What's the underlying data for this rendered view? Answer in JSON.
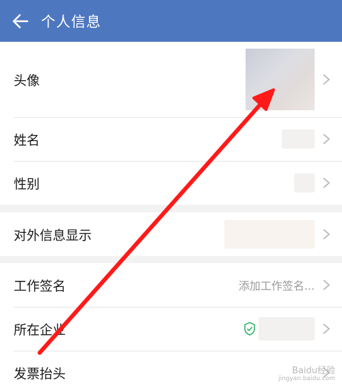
{
  "header": {
    "title": "个人信息",
    "background": "#4d77bf"
  },
  "profile": {
    "avatar_label": "头像",
    "name_label": "姓名",
    "gender_label": "性别"
  },
  "external": {
    "display_label": "对外信息显示"
  },
  "work": {
    "signature_label": "工作签名",
    "signature_placeholder": "添加工作签名...",
    "company_label": "所在企业",
    "invoice_label": "发票抬头"
  },
  "annotation": {
    "arrow_color": "#ff1a1a"
  },
  "watermark": {
    "brand": "Baidu经验",
    "url": "jingyan.baidu.com"
  }
}
